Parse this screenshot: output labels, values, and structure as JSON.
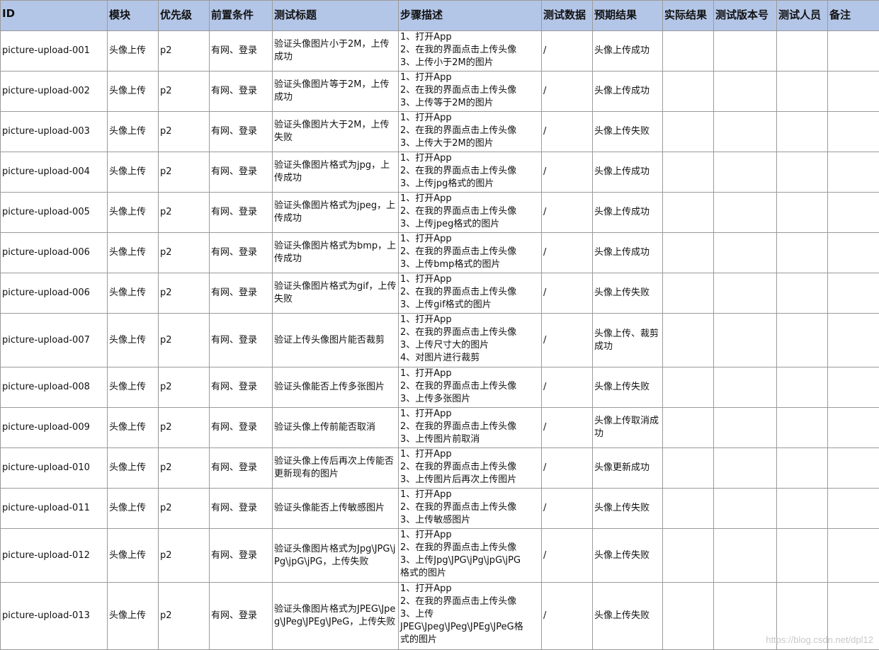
{
  "headers": [
    "ID",
    "模块",
    "优先级",
    "前置条件",
    "测试标题",
    "步骤描述",
    "测试数据",
    "预期结果",
    "实际结果",
    "测试版本号",
    "测试人员",
    "备注"
  ],
  "rows": [
    {
      "id": "picture-upload-001",
      "module": "头像上传",
      "priority": "p2",
      "precondition": "有网、登录",
      "title": "验证头像图片小于2M，上传成功",
      "steps": [
        "1、打开App",
        "2、在我的界面点击上传头像",
        "3、上传小于2M的图片"
      ],
      "data": "/",
      "expected": "头像上传成功",
      "actual": "",
      "version": "",
      "tester": "",
      "note": ""
    },
    {
      "id": "picture-upload-002",
      "module": "头像上传",
      "priority": "p2",
      "precondition": "有网、登录",
      "title": "验证头像图片等于2M，上传成功",
      "steps": [
        "1、打开App",
        "2、在我的界面点击上传头像",
        "3、上传等于2M的图片"
      ],
      "data": "/",
      "expected": "头像上传成功",
      "actual": "",
      "version": "",
      "tester": "",
      "note": ""
    },
    {
      "id": "picture-upload-003",
      "module": "头像上传",
      "priority": "p2",
      "precondition": "有网、登录",
      "title": "验证头像图片大于2M，上传失败",
      "steps": [
        "1、打开App",
        "2、在我的界面点击上传头像",
        "3、上传大于2M的图片"
      ],
      "data": "/",
      "expected": "头像上传失败",
      "actual": "",
      "version": "",
      "tester": "",
      "note": ""
    },
    {
      "id": "picture-upload-004",
      "module": "头像上传",
      "priority": "p2",
      "precondition": "有网、登录",
      "title": "验证头像图片格式为jpg，上传成功",
      "steps": [
        "1、打开App",
        "2、在我的界面点击上传头像",
        "3、上传jpg格式的图片"
      ],
      "data": "/",
      "expected": "头像上传成功",
      "actual": "",
      "version": "",
      "tester": "",
      "note": ""
    },
    {
      "id": "picture-upload-005",
      "module": "头像上传",
      "priority": "p2",
      "precondition": "有网、登录",
      "title": "验证头像图片格式为jpeg，上传成功",
      "steps": [
        "1、打开App",
        "2、在我的界面点击上传头像",
        "3、上传jpeg格式的图片"
      ],
      "data": "/",
      "expected": "头像上传成功",
      "actual": "",
      "version": "",
      "tester": "",
      "note": ""
    },
    {
      "id": "picture-upload-006",
      "module": "头像上传",
      "priority": "p2",
      "precondition": "有网、登录",
      "title": "验证头像图片格式为bmp，上传成功",
      "steps": [
        "1、打开App",
        "2、在我的界面点击上传头像",
        "3、上传bmp格式的图片"
      ],
      "data": "/",
      "expected": "头像上传成功",
      "actual": "",
      "version": "",
      "tester": "",
      "note": ""
    },
    {
      "id": "picture-upload-006",
      "module": "头像上传",
      "priority": "p2",
      "precondition": "有网、登录",
      "title": "验证头像图片格式为gif，上传失败",
      "steps": [
        "1、打开App",
        "2、在我的界面点击上传头像",
        "3、上传gif格式的图片"
      ],
      "data": "/",
      "expected": "头像上传失败",
      "actual": "",
      "version": "",
      "tester": "",
      "note": ""
    },
    {
      "id": "picture-upload-007",
      "module": "头像上传",
      "priority": "p2",
      "precondition": "有网、登录",
      "title": "验证上传头像图片能否裁剪",
      "steps": [
        "1、打开App",
        "2、在我的界面点击上传头像",
        "3、上传尺寸大的图片",
        "4、对图片进行裁剪"
      ],
      "data": "/",
      "expected": "头像上传、裁剪成功",
      "actual": "",
      "version": "",
      "tester": "",
      "note": ""
    },
    {
      "id": "picture-upload-008",
      "module": "头像上传",
      "priority": "p2",
      "precondition": "有网、登录",
      "title": "验证头像能否上传多张图片",
      "steps": [
        "1、打开App",
        "2、在我的界面点击上传头像",
        "3、上传多张图片"
      ],
      "data": "/",
      "expected": "头像上传失败",
      "actual": "",
      "version": "",
      "tester": "",
      "note": ""
    },
    {
      "id": "picture-upload-009",
      "module": "头像上传",
      "priority": "p2",
      "precondition": "有网、登录",
      "title": "验证头像上传前能否取消",
      "steps": [
        "1、打开App",
        "2、在我的界面点击上传头像",
        "3、上传图片前取消"
      ],
      "data": "/",
      "expected": "头像上传取消成功",
      "actual": "",
      "version": "",
      "tester": "",
      "note": ""
    },
    {
      "id": "picture-upload-010",
      "module": "头像上传",
      "priority": "p2",
      "precondition": "有网、登录",
      "title": "验证头像上传后再次上传能否更新现有的图片",
      "steps": [
        "1、打开App",
        "2、在我的界面点击上传头像",
        "3、上传图片后再次上传图片"
      ],
      "data": "/",
      "expected": "头像更新成功",
      "actual": "",
      "version": "",
      "tester": "",
      "note": ""
    },
    {
      "id": "picture-upload-011",
      "module": "头像上传",
      "priority": "p2",
      "precondition": "有网、登录",
      "title": "验证头像能否上传敏感图片",
      "steps": [
        "1、打开App",
        "2、在我的界面点击上传头像",
        "3、上传敏感图片"
      ],
      "data": "/",
      "expected": "头像上传失败",
      "actual": "",
      "version": "",
      "tester": "",
      "note": ""
    },
    {
      "id": "picture-upload-012",
      "module": "头像上传",
      "priority": "p2",
      "precondition": "有网、登录",
      "title": "验证头像图片格式为Jpg\\JPG\\jPg\\jpG\\jPG，上传失败",
      "steps": [
        "1、打开App",
        "2、在我的界面点击上传头像",
        "3、上传Jpg\\JPG\\jPg\\jpG\\jPG",
        "格式的图片"
      ],
      "data": "/",
      "expected": "头像上传失败",
      "actual": "",
      "version": "",
      "tester": "",
      "note": ""
    },
    {
      "id": "picture-upload-013",
      "module": "头像上传",
      "priority": "p2",
      "precondition": "有网、登录",
      "title": "验证头像图片格式为JPEG\\Jpeg\\JPeg\\JPEg\\JPeG，上传失败",
      "steps": [
        "1、打开App",
        "2、在我的界面点击上传头像",
        "3、上传",
        "JPEG\\Jpeg\\JPeg\\JPEg\\JPeG格",
        "式的图片"
      ],
      "data": "/",
      "expected": "头像上传失败",
      "actual": "",
      "version": "",
      "tester": "",
      "note": ""
    }
  ],
  "watermark": "https://blog.csdn.net/dpl12"
}
